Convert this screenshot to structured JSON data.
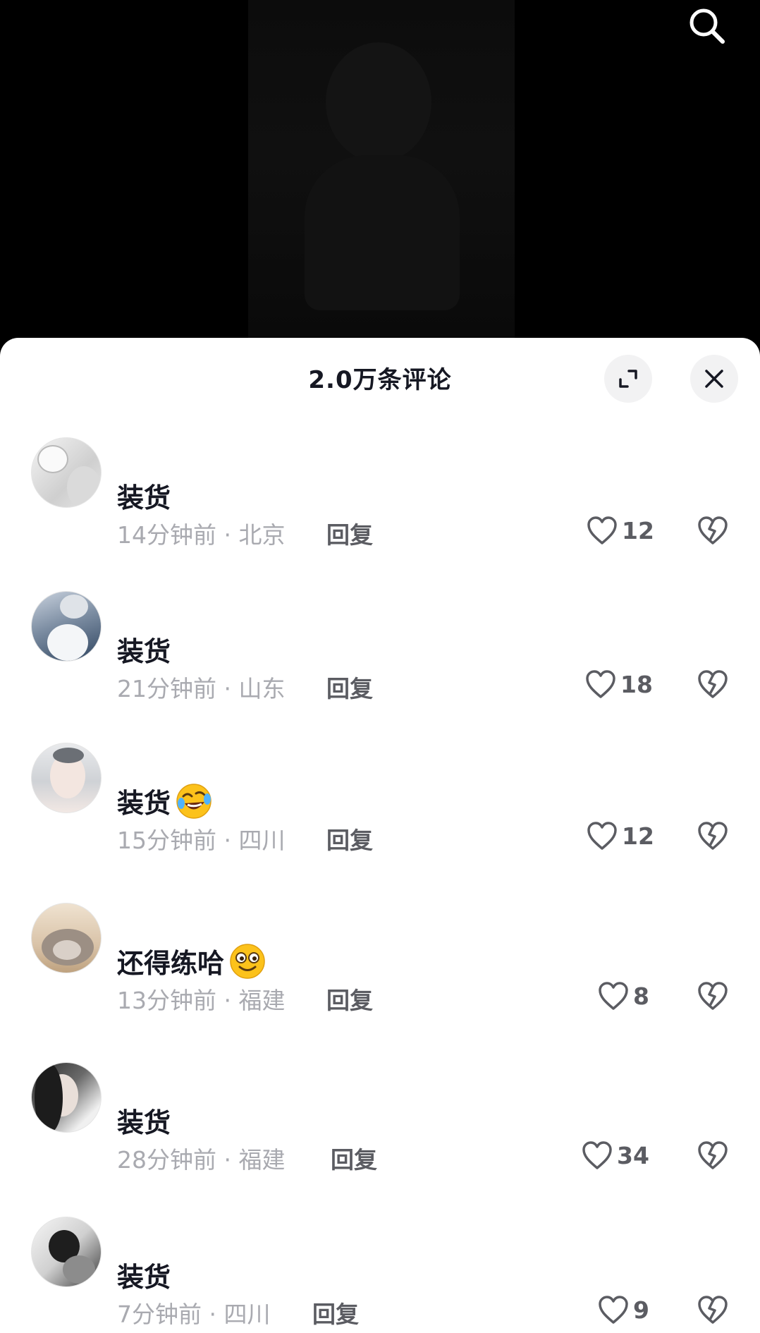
{
  "header": {
    "title": "2.0万条评论",
    "expand_icon": "expand-icon",
    "close_icon": "close-icon"
  },
  "top_bar": {
    "search_icon": "search-icon"
  },
  "comments": [
    {
      "text": "装货",
      "emoji": "",
      "meta": "14分钟前 · 北京",
      "reply": "回复",
      "likes": "12"
    },
    {
      "text": "装货",
      "emoji": "",
      "meta": "21分钟前 · 山东",
      "reply": "回复",
      "likes": "18"
    },
    {
      "text": "装货",
      "emoji": "rolling-laughing-emoji",
      "meta": "15分钟前 · 四川",
      "reply": "回复",
      "likes": "12"
    },
    {
      "text": "还得练哈",
      "emoji": "silly-grin-emoji",
      "meta": "13分钟前 · 福建",
      "reply": "回复",
      "likes": "8"
    },
    {
      "text": "装货",
      "emoji": "",
      "meta": "28分钟前 · 福建",
      "reply": "回复",
      "likes": "34"
    },
    {
      "text": "装货",
      "emoji": "",
      "meta": "7分钟前 · 四川",
      "reply": "回复",
      "likes": "9"
    }
  ],
  "colors": {
    "sheet_bg": "#ffffff",
    "text_primary": "#161823",
    "text_secondary": "#a9aab0",
    "action_text": "#5b5c62",
    "button_bg": "#f2f2f3"
  }
}
